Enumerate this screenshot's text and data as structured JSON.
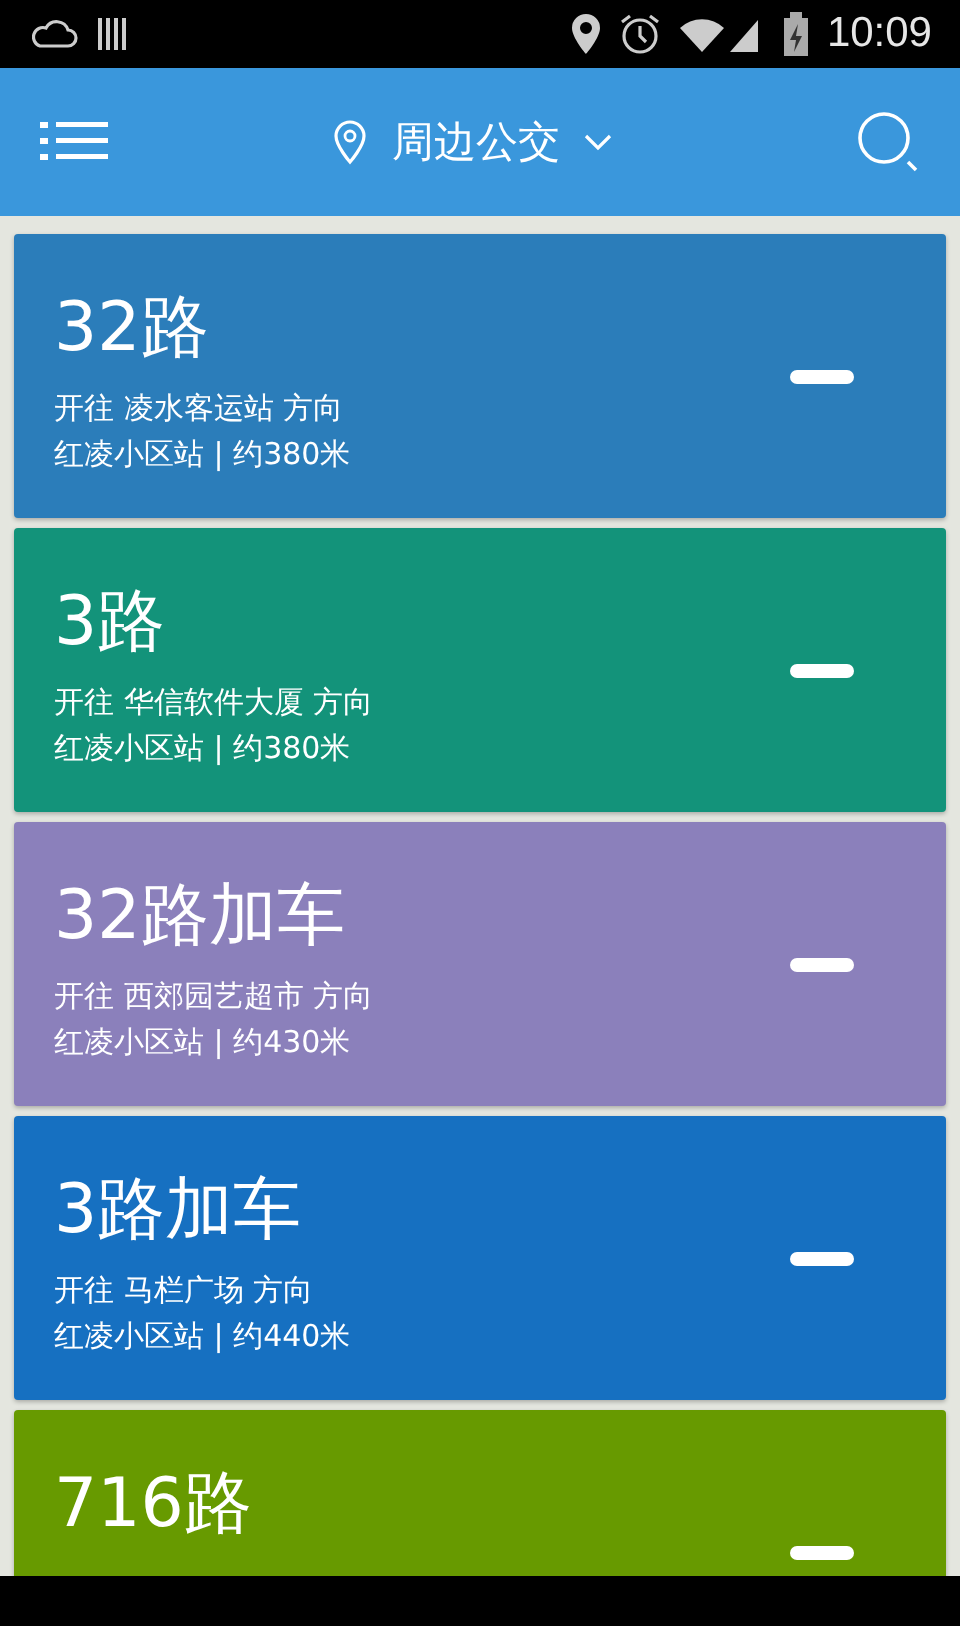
{
  "status_bar": {
    "time": "10:09"
  },
  "app_bar": {
    "title": "周边公交"
  },
  "routes": [
    {
      "name": "32路",
      "direction": "开往 凌水客运站 方向",
      "stop": "红凌小区站 | 约380米",
      "color": "#2b7dba"
    },
    {
      "name": "3路",
      "direction": "开往 华信软件大厦 方向",
      "stop": "红凌小区站 | 约380米",
      "color": "#13937a"
    },
    {
      "name": "32路加车",
      "direction": "开往 西郊园艺超市 方向",
      "stop": "红凌小区站 | 约430米",
      "color": "#8b80bb"
    },
    {
      "name": "3路加车",
      "direction": "开往 马栏广场 方向",
      "stop": "红凌小区站 | 约440米",
      "color": "#1670c1"
    },
    {
      "name": "716路",
      "color": "#679a00"
    }
  ]
}
